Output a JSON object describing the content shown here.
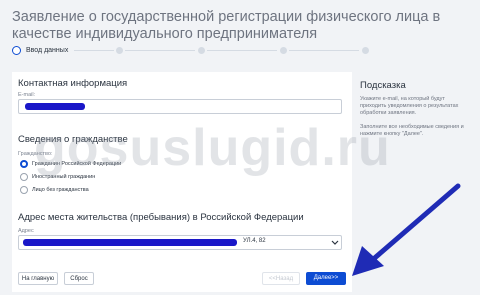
{
  "page": {
    "title": "Заявление о государственной регистрации физического лица в качестве индивидуального предпринимателя",
    "step_current": "Ввод данных"
  },
  "contact": {
    "heading": "Контактная информация",
    "email_label": "E-mail:"
  },
  "citizenship": {
    "heading": "Сведения о гражданстве",
    "label": "Гражданство:",
    "options": [
      {
        "label": "Гражданин Российской Федерации",
        "selected": true
      },
      {
        "label": "Иностранный гражданин",
        "selected": false
      },
      {
        "label": "Лицо без гражданства",
        "selected": false
      }
    ]
  },
  "address": {
    "heading": "Адрес места жительства (пребывания) в Российской Федерации",
    "label": "Адрес",
    "visible_suffix": "УЛ.4, 82"
  },
  "buttons": {
    "home": "На главную",
    "reset": "Сброс",
    "back": "<<Назад",
    "next": "Далее>>"
  },
  "hint": {
    "title": "Подсказка",
    "paragraph1": "Укажите e-mail, на который будут приходить уведомления о результатах обработки заявления.",
    "paragraph2": "Заполните все необходимые сведения и нажмите кнопку \"Далее\"."
  },
  "watermark": "gosuslugid.ru",
  "colors": {
    "accent": "#0d4cd3",
    "redaction": "#1a17c8",
    "page_bg": "#f1f3f6"
  }
}
